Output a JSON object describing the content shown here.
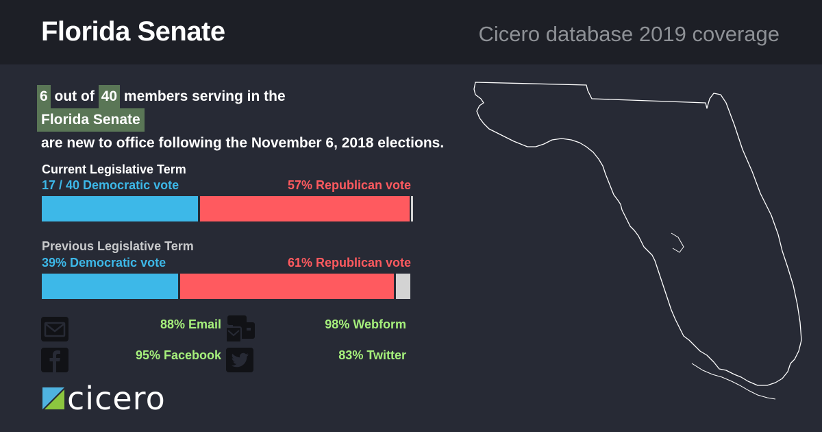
{
  "header": {
    "title": "Florida Senate",
    "subtitle": "Cicero database 2019 coverage"
  },
  "headline": {
    "new_count": "6",
    "text_out_of": "out of",
    "total_count": "40",
    "text_members": "members serving in the",
    "chamber": "Florida Senate",
    "text_rest": "are new to office following the November 6, 2018 elections."
  },
  "current_term": {
    "title": "Current Legislative Term",
    "dem_label": "17 / 40 Democratic vote",
    "rep_label": "57% Republican vote",
    "dem_pct": 42.5,
    "rep_pct": 57,
    "other_pct": 0.5
  },
  "previous_term": {
    "title": "Previous Legislative Term",
    "dem_label": "39% Democratic vote",
    "rep_label": "61% Republican vote",
    "dem_pct": 39,
    "rep_pct": 61,
    "other_pct": 4.2
  },
  "contact_stats": {
    "email": "88% Email",
    "webform": "98% Webform",
    "facebook": "95% Facebook",
    "twitter": "83% Twitter"
  },
  "logo": {
    "text": "cicero"
  },
  "colors": {
    "democratic": "#3db8e8",
    "republican": "#ff5a5f",
    "other": "#d3d3d3",
    "highlight": "#5a7656",
    "stat": "#a6f07c",
    "background": "#272a35",
    "header": "#1d1f26"
  }
}
